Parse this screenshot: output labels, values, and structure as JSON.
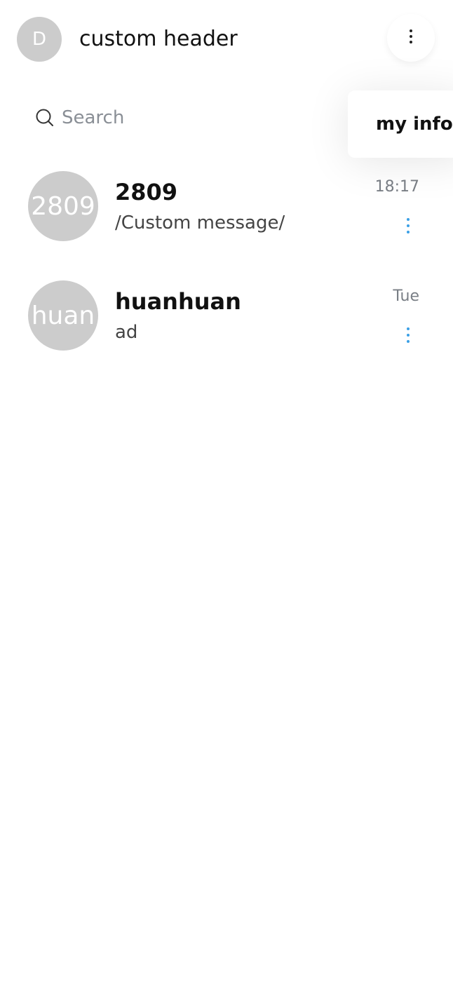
{
  "header": {
    "avatar_letter": "D",
    "title": "custom header",
    "more_icon": "more-vertical-icon"
  },
  "search": {
    "placeholder": "Search",
    "value": ""
  },
  "popup_menu": {
    "items": [
      {
        "label": "my info"
      }
    ]
  },
  "conversations": [
    {
      "avatar_text": "2809",
      "name": "2809",
      "last_message": "/Custom message/",
      "time": "18:17"
    },
    {
      "avatar_text": "huan",
      "name": "huanhuan",
      "last_message": "ad",
      "time": "Tue"
    }
  ],
  "colors": {
    "avatar_bg": "#cccccc",
    "accent": "#3ba0e6",
    "text_primary": "#111111",
    "text_secondary": "#7a7f86"
  }
}
